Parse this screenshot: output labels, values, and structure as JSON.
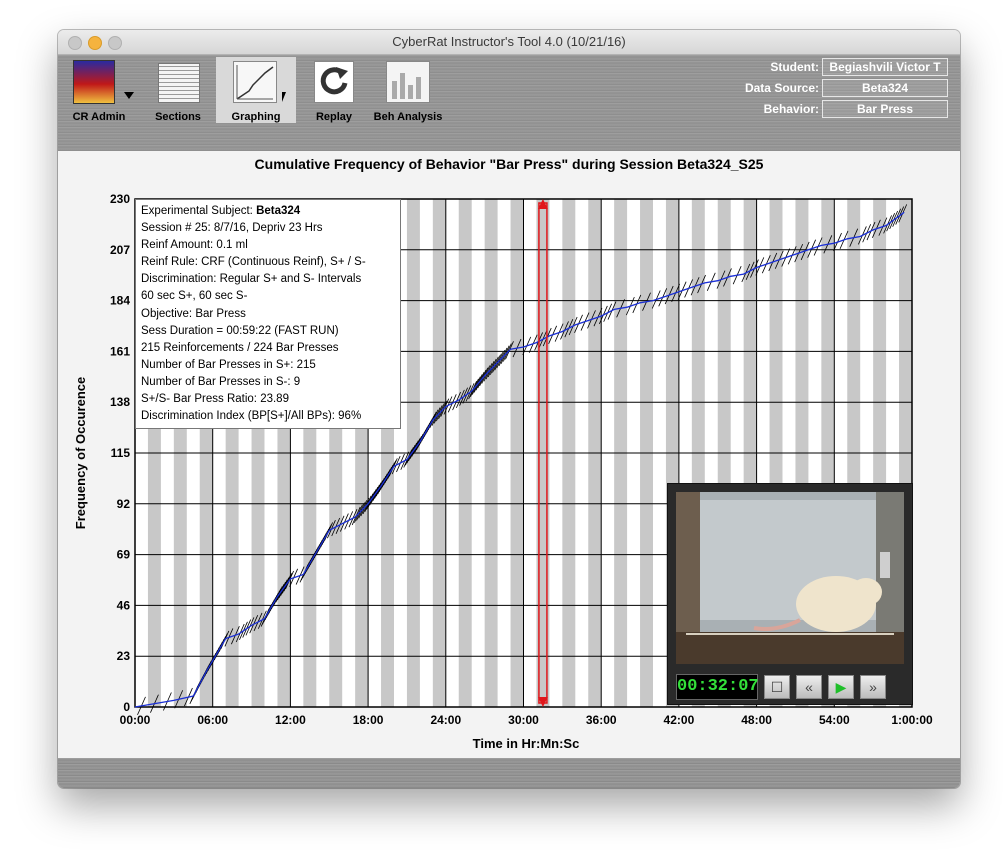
{
  "window": {
    "title": "CyberRat Instructor's Tool 4.0 (10/21/16)"
  },
  "toolbar": {
    "tools": [
      {
        "label": "CR Admin",
        "icon": "cyberrat-logo-icon"
      },
      {
        "label": "Sections",
        "icon": "spreadsheet-icon"
      },
      {
        "label": "Graphing",
        "icon": "cumulative-graph-icon",
        "active": true
      },
      {
        "label": "Replay",
        "icon": "replay-arrow-icon"
      },
      {
        "label": "Beh Analysis",
        "icon": "bar-chart-icon"
      }
    ],
    "student_label": "Student:",
    "student_value": "Begiashvili Victor T",
    "data_source_label": "Data Source:",
    "data_source_value": "Beta324",
    "behavior_label": "Behavior:",
    "behavior_value": "Bar Press"
  },
  "info_box": {
    "subject_prefix": "Experimental Subject: ",
    "subject": "Beta324",
    "lines": [
      "Session # 25: 8/7/16, Depriv 23 Hrs",
      "Reinf Amount: 0.1 ml",
      "Reinf Rule: CRF (Continuous Reinf), S+ / S-",
      "Discrimination: Regular S+ and S- Intervals",
      "60 sec S+, 60 sec S-",
      "Objective: Bar Press",
      "Sess Duration = 00:59:22 (FAST RUN)",
      "215 Reinforcements / 224 Bar Presses",
      "Number of Bar Presses in S+: 215",
      "Number of Bar Presses in S-: 9",
      "S+/S- Bar Press Ratio: 23.89",
      "Discrimination Index (BP[S+]/All BPs): 96%"
    ]
  },
  "video": {
    "timecode": "00:32:07"
  },
  "colors": {
    "line": "#1a2fd6",
    "cursor": "#e0161b",
    "timecode": "#33e03a",
    "sminus_band": "#c8c8c8"
  },
  "chart_data": {
    "type": "line",
    "title": "Cumulative Frequency of Behavior \"Bar Press\" during Session Beta324_S25",
    "xlabel": "Time in Hr:Mn:Sc",
    "ylabel": "Frequency of Occurence",
    "x_unit": "minutes",
    "xlim": [
      0,
      60
    ],
    "ylim": [
      0,
      230
    ],
    "x_ticks": [
      "00:00",
      "06:00",
      "12:00",
      "18:00",
      "24:00",
      "30:00",
      "36:00",
      "42:00",
      "48:00",
      "54:00",
      "1:00:00"
    ],
    "y_ticks": [
      0,
      23,
      46,
      69,
      92,
      115,
      138,
      161,
      184,
      207,
      230
    ],
    "cursor_x": 31.5,
    "series": [
      {
        "x": [
          0,
          3,
          4.5,
          5.5,
          7,
          8,
          9,
          10,
          11,
          12,
          13,
          14,
          15,
          16,
          17,
          18,
          19,
          20,
          21,
          22,
          23,
          24,
          25,
          26,
          27,
          28,
          29,
          30,
          31,
          32,
          33,
          34,
          35,
          36,
          37,
          38,
          39,
          40,
          41,
          42,
          43,
          44,
          45,
          46,
          47,
          48,
          49,
          50,
          51,
          52,
          53,
          54,
          55,
          56,
          57,
          58,
          59.4
        ],
        "y": [
          0,
          3,
          5,
          16,
          31,
          33,
          37,
          40,
          50,
          58,
          60,
          70,
          80,
          83,
          86,
          92,
          100,
          109,
          112,
          120,
          130,
          136,
          139,
          143,
          150,
          156,
          162,
          163,
          165,
          168,
          170,
          173,
          175,
          177,
          180,
          181,
          183,
          184,
          186,
          188,
          190,
          192,
          193,
          195,
          196,
          199,
          201,
          203,
          205,
          207,
          209,
          210,
          212,
          213,
          216,
          218,
          224
        ]
      }
    ]
  }
}
